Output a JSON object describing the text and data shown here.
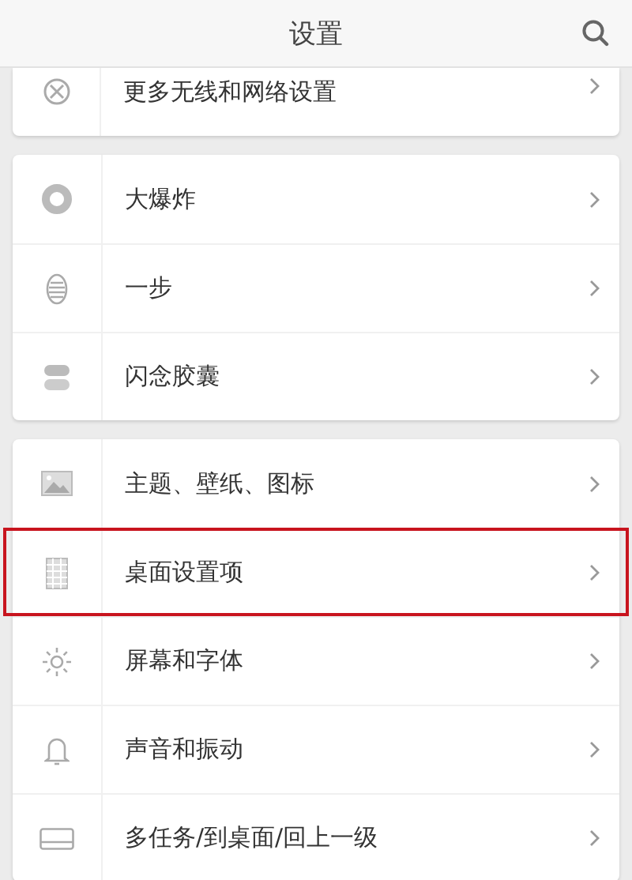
{
  "header": {
    "title": "设置"
  },
  "groups": [
    {
      "items": [
        {
          "label": "更多无线和网络设置",
          "highlighted": false
        }
      ]
    },
    {
      "items": [
        {
          "label": "大爆炸",
          "highlighted": false
        },
        {
          "label": "一步",
          "highlighted": false
        },
        {
          "label": "闪念胶囊",
          "highlighted": false
        }
      ]
    },
    {
      "items": [
        {
          "label": "主题、壁纸、图标",
          "highlighted": false
        },
        {
          "label": "桌面设置项",
          "highlighted": true
        },
        {
          "label": "屏幕和字体",
          "highlighted": false
        },
        {
          "label": "声音和振动",
          "highlighted": false
        },
        {
          "label": "多任务/到桌面/回上一级",
          "highlighted": false
        }
      ]
    }
  ]
}
